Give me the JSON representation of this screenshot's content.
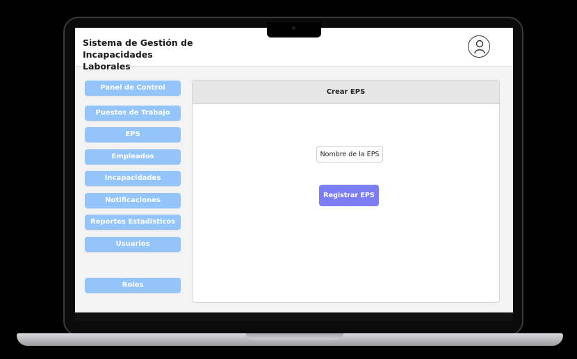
{
  "header": {
    "title_line1": "Sistema de Gestión de",
    "title_line2": "Incapacidades Laborales",
    "avatar_icon": "user-icon"
  },
  "sidebar": {
    "items": [
      {
        "label": "Panel de Control"
      },
      {
        "label": "Puestos de Trabajo"
      },
      {
        "label": "EPS"
      },
      {
        "label": "Empleados"
      },
      {
        "label": "Incapacidades"
      },
      {
        "label": "Notificaciones"
      },
      {
        "label": "Reportes Estadisticos"
      },
      {
        "label": "Usuarios"
      },
      {
        "label": "Roles"
      }
    ]
  },
  "panel": {
    "title": "Crear EPS",
    "input_placeholder": "Nombre de la EPS",
    "submit_label": "Registrar EPS"
  },
  "colors": {
    "sidebar_button": "#93c5fb",
    "submit_button": "#7b7ef5",
    "panel_header": "#e6e6e6"
  }
}
